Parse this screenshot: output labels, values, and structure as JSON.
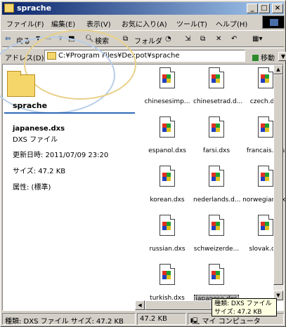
{
  "window": {
    "title": "sprache"
  },
  "menu": [
    "ファイル(F)",
    "編集(E)",
    "表示(V)",
    "お気に入り(A)",
    "ツール(T)",
    "ヘルプ(H)"
  ],
  "toolbar": {
    "back": "戻る",
    "search": "検索",
    "folders": "フォルダ"
  },
  "address": {
    "label": "アドレス(D)",
    "path": "C:¥Program Files¥Dexpot¥sprache",
    "go": "移動"
  },
  "left_panel": {
    "folder_name": "sprache",
    "file_name": "japanese.dxs",
    "file_type": "DXS ファイル",
    "modified": "更新日時: 2011/07/09 23:20",
    "size": "サイズ: 47.2 KB",
    "attributes": "属性: (標準)"
  },
  "files": [
    "chinesesimp...",
    "chinesetrad.d...",
    "czech.dxs",
    "espanol.dxs",
    "farsi.dxs",
    "francais.dxs",
    "korean.dxs",
    "nederlands.d...",
    "norwegian.dxs",
    "russian.dxs",
    "schweizerde...",
    "slovak.dxs",
    "turkish.dxs",
    "japanese.dxs"
  ],
  "tooltip": {
    "line1": "種類: DXS ファイル",
    "line2": "サイズ: 47.2 KB"
  },
  "status": {
    "left": "種類: DXS ファイル サイズ: 47.2 KB",
    "size": "47.2 KB",
    "location": "マイ コンピュータ"
  }
}
